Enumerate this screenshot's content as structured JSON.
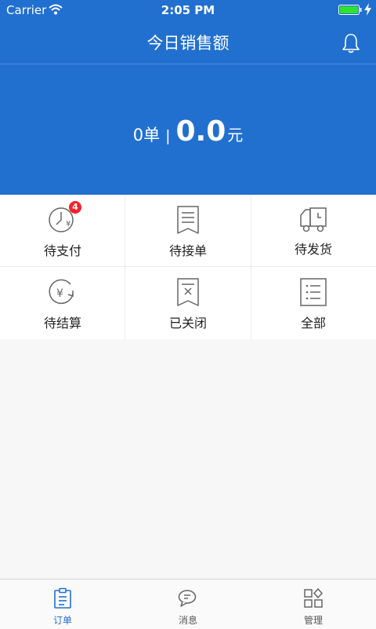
{
  "status_bar": {
    "carrier": "Carrier",
    "time": "2:05 PM"
  },
  "header": {
    "title": "今日销售额",
    "order_count": "0单",
    "separator": "|",
    "amount": "0.0",
    "unit": "元",
    "accent_color": "#2170cf"
  },
  "orders": [
    {
      "label": "待支付",
      "icon": "clock-yen-icon",
      "badge": "4"
    },
    {
      "label": "待接单",
      "icon": "receipt-icon"
    },
    {
      "label": "待发货",
      "icon": "truck-icon"
    },
    {
      "label": "待结算",
      "icon": "yen-refresh-icon"
    },
    {
      "label": "已关闭",
      "icon": "closed-receipt-icon"
    },
    {
      "label": "全部",
      "icon": "list-icon"
    }
  ],
  "tabbar": {
    "items": [
      {
        "label": "订单",
        "icon": "clipboard-icon",
        "active": true
      },
      {
        "label": "消息",
        "icon": "chat-icon",
        "active": false
      },
      {
        "label": "管理",
        "icon": "grid-icon",
        "active": false
      }
    ]
  }
}
